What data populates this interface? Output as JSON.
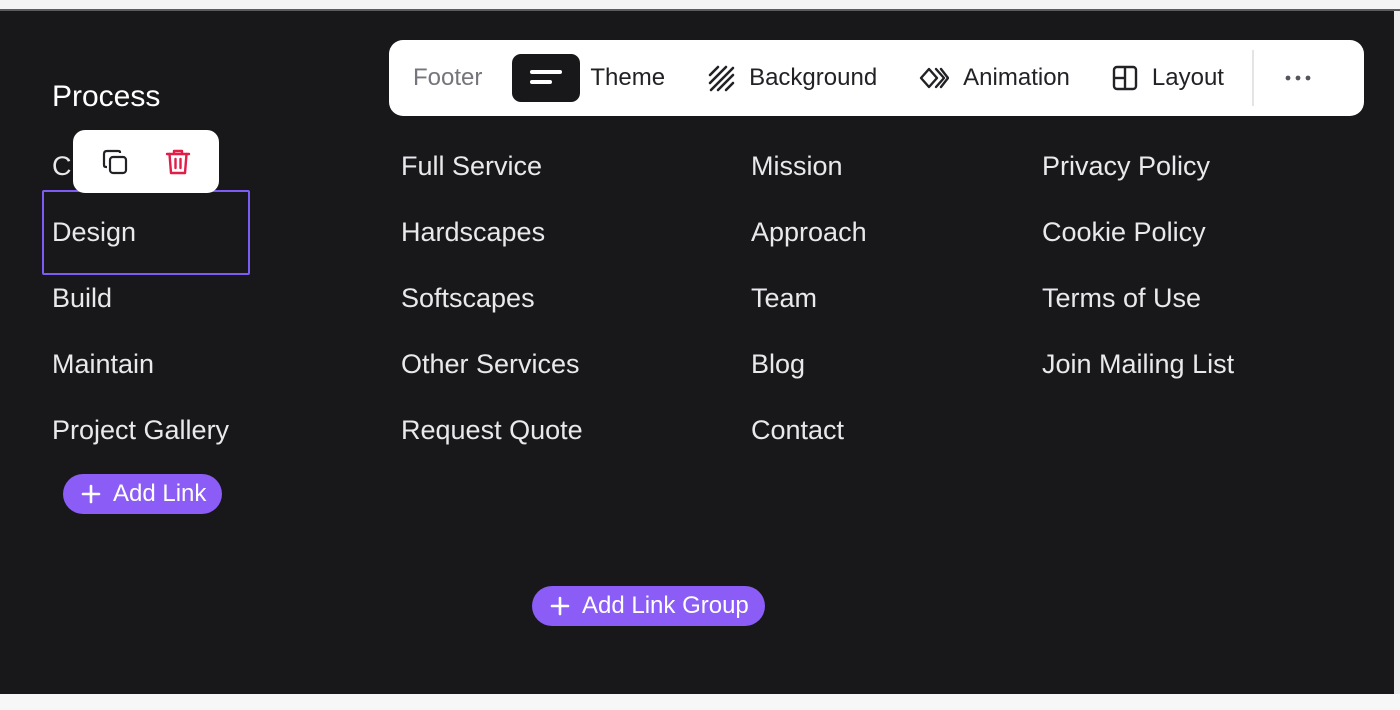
{
  "toolbar": {
    "label": "Footer",
    "items": [
      {
        "label": "Theme",
        "icon": "theme-icon"
      },
      {
        "label": "Background",
        "icon": "background-stripes-icon"
      },
      {
        "label": "Animation",
        "icon": "animation-icon"
      },
      {
        "label": "Layout",
        "icon": "layout-icon"
      }
    ],
    "more_icon": "more-horizontal-icon"
  },
  "footer": {
    "column1": {
      "title": "Process",
      "links": [
        "Consult",
        "Design",
        "Build",
        "Maintain",
        "Project Gallery"
      ],
      "visible_first_fragment": "C",
      "add_link_label": "Add Link"
    },
    "column2": {
      "links": [
        "Full Service",
        "Hardscapes",
        "Softscapes",
        "Other Services",
        "Request Quote"
      ]
    },
    "column3": {
      "links": [
        "Mission",
        "Approach",
        "Team",
        "Blog",
        "Contact"
      ]
    },
    "column4": {
      "links": [
        "Privacy Policy",
        "Cookie Policy",
        "Terms of Use",
        "Join Mailing List"
      ]
    },
    "add_link_group_label": "Add Link Group"
  },
  "item_actions": {
    "duplicate_icon": "duplicate-icon",
    "delete_icon": "trash-icon"
  },
  "colors": {
    "footer_bg": "#18181b",
    "accent": "#8b5cf6",
    "selection": "#7c5cf2",
    "delete": "#e11d48",
    "text": "#e9e9ec"
  }
}
